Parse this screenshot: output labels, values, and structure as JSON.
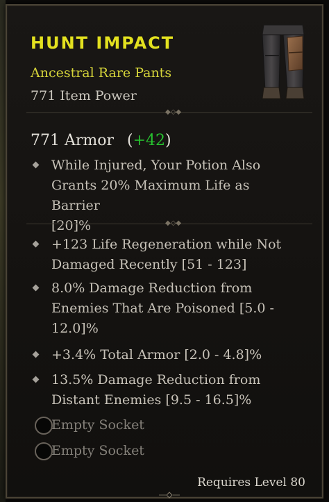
{
  "item": {
    "name": "HUNT IMPACT",
    "type": "Ancestral Rare Pants",
    "item_power": "771 Item Power",
    "armor_value": "771 Armor",
    "armor_open": "(",
    "armor_bonus": "+42",
    "armor_close": ")",
    "implicit": "While Injured, Your Potion Also\nGrants 20% Maximum Life as Barrier\n[20]%",
    "affixes": [
      "+123 Life Regeneration while Not\nDamaged Recently [51 - 123]",
      "8.0% Damage Reduction from\nEnemies That Are Poisoned [5.0 -\n12.0]%",
      "+3.4% Total Armor [2.0 - 4.8]%",
      "13.5% Damage Reduction from\nDistant Enemies [9.5 - 16.5]%"
    ],
    "sockets": [
      "Empty Socket",
      "Empty Socket"
    ],
    "requirement": "Requires Level 80"
  },
  "colors": {
    "title": "#e3e11f",
    "subtitle": "#d5d43a",
    "bonus": "#27c12f",
    "text": "#c7c2b8"
  },
  "icons": {
    "item_image": "pants-icon",
    "bullet": "diamond-bullet-icon",
    "socket": "empty-socket-icon",
    "divider": "ornament-divider-icon"
  }
}
